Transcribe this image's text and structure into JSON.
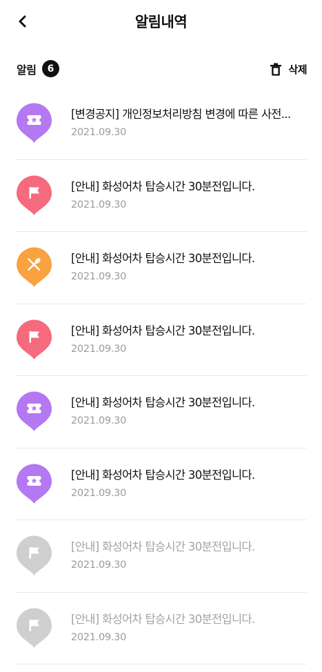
{
  "header": {
    "title": "알림내역",
    "back_icon": "chevron-left-icon"
  },
  "summary": {
    "label": "알림",
    "count": "6",
    "delete_label": "삭제",
    "delete_icon": "trash-icon"
  },
  "colors": {
    "purple": "#b478f2",
    "red": "#f56a7d",
    "orange": "#f9a23f",
    "gray": "#cfcfcf"
  },
  "notifications": [
    {
      "title": "[변경공지] 개인정보처리방침 변경에 따른 사전...",
      "date": "2021.09.30",
      "icon": "ticket-icon",
      "color": "#b478f2",
      "read": false
    },
    {
      "title": "[안내] 화성어차 탑승시간 30분전입니다.",
      "date": "2021.09.30",
      "icon": "flag-icon",
      "color": "#f56a7d",
      "read": false
    },
    {
      "title": "[안내] 화성어차 탑승시간 30분전입니다.",
      "date": "2021.09.30",
      "icon": "fork-spoon-icon",
      "color": "#f9a23f",
      "read": false
    },
    {
      "title": "[안내] 화성어차 탑승시간 30분전입니다.",
      "date": "2021.09.30",
      "icon": "flag-icon",
      "color": "#f56a7d",
      "read": false
    },
    {
      "title": "[안내] 화성어차 탑승시간 30분전입니다.",
      "date": "2021.09.30",
      "icon": "ticket-icon",
      "color": "#b478f2",
      "read": false
    },
    {
      "title": "[안내] 화성어차 탑승시간 30분전입니다.",
      "date": "2021.09.30",
      "icon": "ticket-icon",
      "color": "#b478f2",
      "read": false
    },
    {
      "title": "[안내] 화성어차 탑승시간 30분전입니다.",
      "date": "2021.09.30",
      "icon": "flag-icon",
      "color": "#cfcfcf",
      "read": true
    },
    {
      "title": "[안내] 화성어차 탑승시간 30분전입니다.",
      "date": "2021.09.30",
      "icon": "flag-icon",
      "color": "#cfcfcf",
      "read": true
    }
  ]
}
